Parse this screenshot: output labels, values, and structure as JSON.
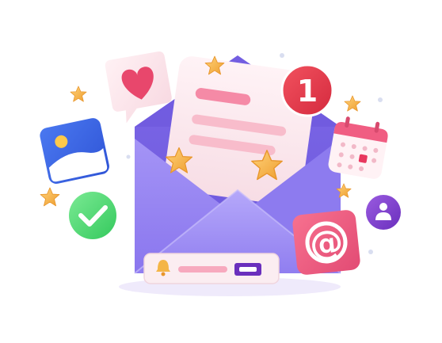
{
  "illustration": {
    "notification_count": "1",
    "email_symbol": "@"
  },
  "colors": {
    "envelope": "#8B78F0",
    "envelope_dark": "#6F5CE0",
    "letter": "#FBE9EE",
    "accent_pink": "#F56B8E",
    "red_badge": "#E8374A",
    "star": "#F4B547",
    "green": "#4FD873",
    "purple": "#7A3FC9",
    "blue": "#3A63E0"
  },
  "icons": [
    "heart-icon",
    "notification-badge",
    "calendar-icon",
    "image-icon",
    "checkmark-icon",
    "user-icon",
    "at-sign-icon",
    "bell-icon",
    "star-icon"
  ]
}
